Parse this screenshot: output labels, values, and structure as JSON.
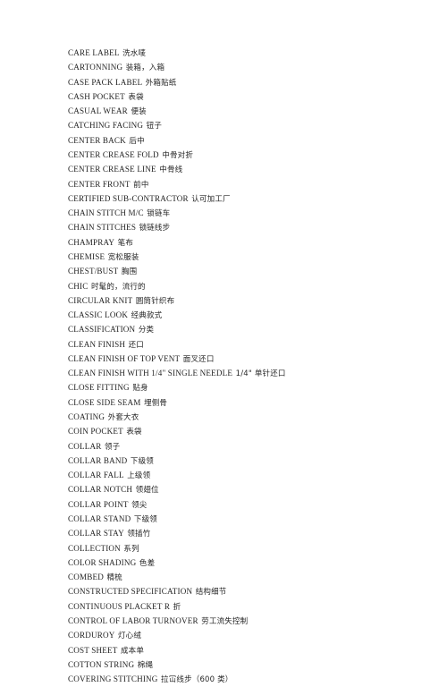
{
  "document": {
    "type": "glossary-page",
    "language_pair": "English-Chinese",
    "subject": "garment manufacturing terminology",
    "background_color": "#ffffff",
    "text_color": "#232323",
    "entry_count": 44,
    "entries": [
      {
        "term": "CARE LABEL",
        "gloss": "洗水唛"
      },
      {
        "term": "CARTONNING",
        "gloss": "装箱，入箱"
      },
      {
        "term": "CASE PACK LABEL",
        "gloss": "外箱贴纸"
      },
      {
        "term": "CASH POCKET",
        "gloss": "表袋"
      },
      {
        "term": "CASUAL WEAR",
        "gloss": "便装"
      },
      {
        "term": "CATCHING FACING",
        "gloss": "钮子"
      },
      {
        "term": "CENTER BACK",
        "gloss": "后中"
      },
      {
        "term": "CENTER CREASE FOLD",
        "gloss": "中骨对折"
      },
      {
        "term": "CENTER CREASE LINE",
        "gloss": "中骨线"
      },
      {
        "term": "CENTER FRONT",
        "gloss": "前中"
      },
      {
        "term": "CERTIFIED SUB-CONTRACTOR",
        "gloss": "认可加工厂"
      },
      {
        "term": "CHAIN STITCH M/C",
        "gloss": "锁链车"
      },
      {
        "term": "CHAIN STITCHES",
        "gloss": "锁链线步"
      },
      {
        "term": "CHAMPRAY",
        "gloss": "笔布"
      },
      {
        "term": "CHEMISE",
        "gloss": "宽松服装"
      },
      {
        "term": "CHEST/BUST",
        "gloss": "胸围"
      },
      {
        "term": "CHIC",
        "gloss": "时髦的，流行的"
      },
      {
        "term": "CIRCULAR KNIT",
        "gloss": "圆筒针织布"
      },
      {
        "term": "CLASSIC LOOK",
        "gloss": "经典款式"
      },
      {
        "term": "CLASSIFICATION",
        "gloss": "分类"
      },
      {
        "term": "CLEAN FINISH",
        "gloss": "还口"
      },
      {
        "term": "CLEAN FINISH OF TOP VENT",
        "gloss": "面叉还口"
      },
      {
        "term": "CLEAN FINISH WITH 1/4\" SINGLE NEEDLE",
        "gloss": "1/4\" 单针还口"
      },
      {
        "term": "CLOSE FITTING",
        "gloss": "贴身"
      },
      {
        "term": "CLOSE SIDE SEAM",
        "gloss": "埋侧骨"
      },
      {
        "term": "COATING",
        "gloss": "外套大衣"
      },
      {
        "term": "COIN POCKET",
        "gloss": "表袋"
      },
      {
        "term": "COLLAR",
        "gloss": "领子"
      },
      {
        "term": "COLLAR BAND",
        "gloss": "下级领"
      },
      {
        "term": "COLLAR FALL",
        "gloss": "上级领"
      },
      {
        "term": "COLLAR NOTCH",
        "gloss": "领翅位"
      },
      {
        "term": "COLLAR POINT",
        "gloss": "领尖"
      },
      {
        "term": "COLLAR STAND",
        "gloss": "下级领"
      },
      {
        "term": "COLLAR STAY",
        "gloss": "领插竹"
      },
      {
        "term": "COLLECTION",
        "gloss": "系列"
      },
      {
        "term": "COLOR SHADING",
        "gloss": "色差"
      },
      {
        "term": "COMBED",
        "gloss": "精梳"
      },
      {
        "term": "CONSTRUCTED SPECIFICATION",
        "gloss": "结构细节"
      },
      {
        "term": "CONTINUOUS PLACKET R",
        "gloss": "折"
      },
      {
        "term": "CONTROL OF LABOR TURNOVER",
        "gloss": "劳工流失控制"
      },
      {
        "term": "CORDUROY",
        "gloss": "灯心绒"
      },
      {
        "term": "COST SHEET",
        "gloss": "成本单"
      },
      {
        "term": "COTTON STRING",
        "gloss": "棉绳"
      },
      {
        "term": "COVERING STITCHING",
        "gloss": "拉冚线步（600 类）"
      }
    ]
  }
}
